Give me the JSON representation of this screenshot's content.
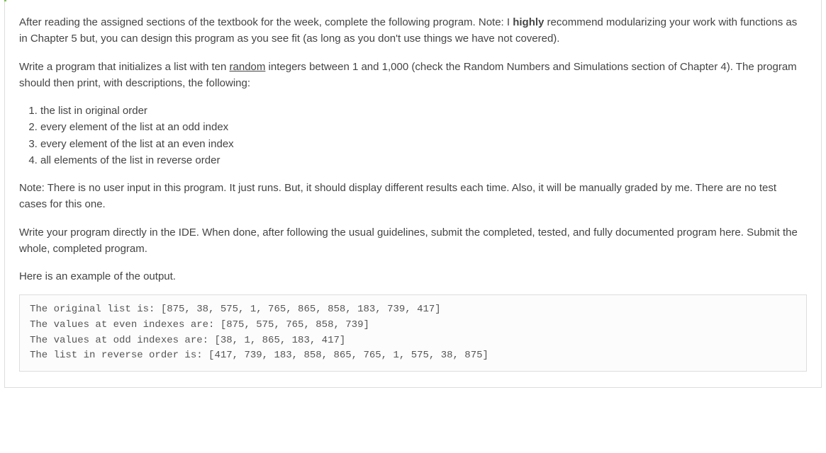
{
  "para1": {
    "before": "After reading the assigned sections of the textbook for the week, complete the following program. Note: I ",
    "bold": "highly",
    "after": " recommend modularizing your work with functions as in Chapter 5 but, you can design this program as you see fit (as long as you don't use things we have not covered)."
  },
  "para2": {
    "before": "Write a program that initializes a list with ten ",
    "underlined": "random",
    "after": " integers between 1 and 1,000 (check the Random Numbers and Simulations section of Chapter 4). The program should then print, with descriptions, the following:"
  },
  "list_items": [
    "the list in original order",
    "every element of the list at an odd index",
    "every element of the list at an even index",
    "all elements of the list in reverse order"
  ],
  "para3": "Note: There is no user input in this program. It just runs. But, it should display different results each time. Also, it will be manually graded by me. There are no test cases for this one.",
  "para4": "Write your program directly in the IDE. When done, after following the usual guidelines, submit the completed, tested, and fully documented program here. Submit the whole, completed program.",
  "para5": "Here is an example of the output.",
  "code_lines": [
    "The original list is: [875, 38, 575, 1, 765, 865, 858, 183, 739, 417]",
    "The values at even indexes are: [875, 575, 765, 858, 739]",
    "The values at odd indexes are: [38, 1, 865, 183, 417]",
    "The list in reverse order is: [417, 739, 183, 858, 865, 765, 1, 575, 38, 875]"
  ]
}
